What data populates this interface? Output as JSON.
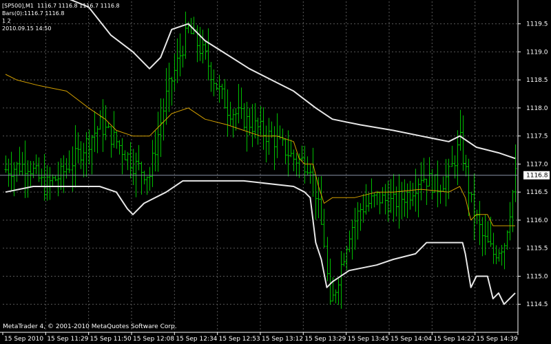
{
  "header": {
    "line1": "[SP500],M1  1116.7 1116.8 1116.7 1116.8",
    "line2": "Bars(0):1116.7 1116.8",
    "line3": "1 2",
    "line4": "2010.09.15 14:50"
  },
  "footer": {
    "copyright": "MetaTrader 4, © 2001-2010 MetaQuotes Software Corp."
  },
  "colors": {
    "background": "#000000",
    "bars": "#00c000",
    "bollinger": "#e8e8e8",
    "ma": "#d4a000",
    "grid": "#5a5a5a",
    "current_price_line": "#8a94a8"
  },
  "chart_data": {
    "type": "bar",
    "symbol": "SP500",
    "timeframe": "M1",
    "current_price": "1116.8",
    "ylim": [
      1114.0,
      1119.9
    ],
    "y_ticks": [
      "1119.5",
      "1119.0",
      "1118.5",
      "1118.0",
      "1117.5",
      "1117.0",
      "1116.5",
      "1116.0",
      "1115.5",
      "1115.0",
      "1114.5"
    ],
    "x_ticks": [
      "15 Sep 2010",
      "15 Sep 11:29",
      "15 Sep 11:50",
      "15 Sep 12:08",
      "15 Sep 12:34",
      "15 Sep 12:53",
      "15 Sep 13:12",
      "15 Sep 13:29",
      "15 Sep 13:45",
      "15 Sep 14:04",
      "15 Sep 14:22",
      "15 Sep 14:39"
    ],
    "bar_count": 185,
    "price_path": [
      [
        0,
        1116.9
      ],
      [
        8,
        1117.0
      ],
      [
        14,
        1116.6
      ],
      [
        20,
        1116.8
      ],
      [
        28,
        1117.3
      ],
      [
        34,
        1117.7
      ],
      [
        40,
        1117.4
      ],
      [
        46,
        1117.0
      ],
      [
        52,
        1116.8
      ],
      [
        54,
        1117.3
      ],
      [
        58,
        1118.2
      ],
      [
        62,
        1118.8
      ],
      [
        66,
        1119.4
      ],
      [
        72,
        1118.9
      ],
      [
        76,
        1118.4
      ],
      [
        80,
        1118.0
      ],
      [
        86,
        1117.8
      ],
      [
        92,
        1117.6
      ],
      [
        98,
        1117.4
      ],
      [
        104,
        1117.1
      ],
      [
        110,
        1117.0
      ],
      [
        112,
        1116.5
      ],
      [
        115,
        1115.6
      ],
      [
        117,
        1114.4
      ],
      [
        120,
        1115.0
      ],
      [
        124,
        1115.8
      ],
      [
        128,
        1116.2
      ],
      [
        134,
        1116.4
      ],
      [
        140,
        1116.3
      ],
      [
        146,
        1116.5
      ],
      [
        150,
        1116.8
      ],
      [
        156,
        1116.6
      ],
      [
        160,
        1116.8
      ],
      [
        164,
        1117.4
      ],
      [
        168,
        1116.3
      ],
      [
        172,
        1115.7
      ],
      [
        176,
        1115.4
      ],
      [
        180,
        1115.6
      ],
      [
        184,
        1116.8
      ]
    ],
    "upper_band": [
      [
        0,
        1120.2
      ],
      [
        20,
        1120.0
      ],
      [
        30,
        1119.8
      ],
      [
        38,
        1119.3
      ],
      [
        46,
        1119.0
      ],
      [
        52,
        1118.7
      ],
      [
        56,
        1118.9
      ],
      [
        60,
        1119.4
      ],
      [
        66,
        1119.5
      ],
      [
        72,
        1119.2
      ],
      [
        80,
        1118.95
      ],
      [
        88,
        1118.7
      ],
      [
        96,
        1118.5
      ],
      [
        104,
        1118.3
      ],
      [
        112,
        1118.0
      ],
      [
        118,
        1117.8
      ],
      [
        128,
        1117.7
      ],
      [
        140,
        1117.6
      ],
      [
        150,
        1117.5
      ],
      [
        160,
        1117.4
      ],
      [
        164,
        1117.5
      ],
      [
        170,
        1117.3
      ],
      [
        178,
        1117.2
      ],
      [
        184,
        1117.1
      ]
    ],
    "lower_band": [
      [
        0,
        1116.5
      ],
      [
        10,
        1116.6
      ],
      [
        20,
        1116.6
      ],
      [
        34,
        1116.6
      ],
      [
        40,
        1116.5
      ],
      [
        44,
        1116.2
      ],
      [
        46,
        1116.1
      ],
      [
        50,
        1116.3
      ],
      [
        58,
        1116.5
      ],
      [
        64,
        1116.7
      ],
      [
        72,
        1116.7
      ],
      [
        86,
        1116.7
      ],
      [
        104,
        1116.6
      ],
      [
        108,
        1116.5
      ],
      [
        110,
        1116.4
      ],
      [
        112,
        1115.6
      ],
      [
        114,
        1115.3
      ],
      [
        116,
        1114.8
      ],
      [
        118,
        1114.9
      ],
      [
        124,
        1115.1
      ],
      [
        134,
        1115.2
      ],
      [
        140,
        1115.3
      ],
      [
        148,
        1115.4
      ],
      [
        152,
        1115.6
      ],
      [
        160,
        1115.6
      ],
      [
        165,
        1115.6
      ],
      [
        166,
        1115.4
      ],
      [
        168,
        1114.8
      ],
      [
        170,
        1115.0
      ],
      [
        174,
        1115.0
      ],
      [
        176,
        1114.6
      ],
      [
        178,
        1114.7
      ],
      [
        180,
        1114.5
      ],
      [
        184,
        1114.7
      ]
    ],
    "moving_average": [
      [
        0,
        1118.6
      ],
      [
        4,
        1118.5
      ],
      [
        12,
        1118.4
      ],
      [
        22,
        1118.3
      ],
      [
        30,
        1118.0
      ],
      [
        36,
        1117.8
      ],
      [
        40,
        1117.6
      ],
      [
        46,
        1117.5
      ],
      [
        52,
        1117.5
      ],
      [
        54,
        1117.6
      ],
      [
        60,
        1117.9
      ],
      [
        66,
        1118.0
      ],
      [
        72,
        1117.8
      ],
      [
        80,
        1117.7
      ],
      [
        86,
        1117.6
      ],
      [
        92,
        1117.5
      ],
      [
        98,
        1117.5
      ],
      [
        104,
        1117.4
      ],
      [
        106,
        1117.1
      ],
      [
        108,
        1117.0
      ],
      [
        111,
        1117.0
      ],
      [
        113,
        1116.6
      ],
      [
        115,
        1116.3
      ],
      [
        118,
        1116.4
      ],
      [
        126,
        1116.4
      ],
      [
        134,
        1116.5
      ],
      [
        140,
        1116.5
      ],
      [
        150,
        1116.55
      ],
      [
        160,
        1116.5
      ],
      [
        164,
        1116.6
      ],
      [
        166,
        1116.4
      ],
      [
        168,
        1116.0
      ],
      [
        170,
        1116.1
      ],
      [
        174,
        1116.1
      ],
      [
        176,
        1115.9
      ],
      [
        180,
        1115.9
      ],
      [
        184,
        1115.9
      ]
    ]
  }
}
